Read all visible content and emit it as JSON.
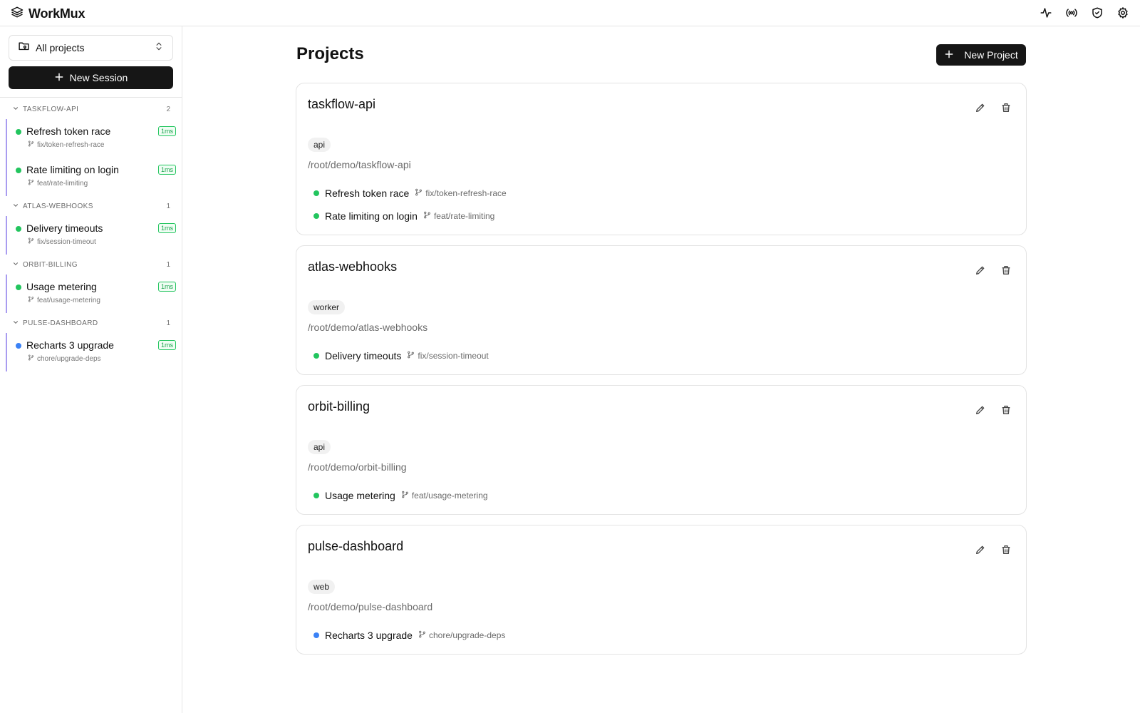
{
  "app": {
    "name": "WorkMux"
  },
  "header": {
    "icons": [
      "activity-icon",
      "broadcast-icon",
      "shield-check-icon",
      "gear-icon"
    ]
  },
  "sidebar": {
    "project_select": "All projects",
    "new_session": "New Session",
    "groups": [
      {
        "name": "TASKFLOW-API",
        "count": "2",
        "sessions": [
          {
            "title": "Refresh token race",
            "branch": "fix/token-refresh-race",
            "badge": "1ms",
            "status": "#22c55e"
          },
          {
            "title": "Rate limiting on login",
            "branch": "feat/rate-limiting",
            "badge": "1ms",
            "status": "#22c55e"
          }
        ]
      },
      {
        "name": "ATLAS-WEBHOOKS",
        "count": "1",
        "sessions": [
          {
            "title": "Delivery timeouts",
            "branch": "fix/session-timeout",
            "badge": "1ms",
            "status": "#22c55e"
          }
        ]
      },
      {
        "name": "ORBIT-BILLING",
        "count": "1",
        "sessions": [
          {
            "title": "Usage metering",
            "branch": "feat/usage-metering",
            "badge": "1ms",
            "status": "#22c55e"
          }
        ]
      },
      {
        "name": "PULSE-DASHBOARD",
        "count": "1",
        "sessions": [
          {
            "title": "Recharts 3 upgrade",
            "branch": "chore/upgrade-deps",
            "badge": "1ms",
            "status": "#3b82f6"
          }
        ]
      }
    ]
  },
  "main": {
    "title": "Projects",
    "new_project": "New Project",
    "projects": [
      {
        "name": "taskflow-api",
        "tag": "api",
        "path": "/root/demo/taskflow-api",
        "sessions": [
          {
            "title": "Refresh token race",
            "branch": "fix/token-refresh-race",
            "status": "#22c55e"
          },
          {
            "title": "Rate limiting on login",
            "branch": "feat/rate-limiting",
            "status": "#22c55e"
          }
        ]
      },
      {
        "name": "atlas-webhooks",
        "tag": "worker",
        "path": "/root/demo/atlas-webhooks",
        "sessions": [
          {
            "title": "Delivery timeouts",
            "branch": "fix/session-timeout",
            "status": "#22c55e"
          }
        ]
      },
      {
        "name": "orbit-billing",
        "tag": "api",
        "path": "/root/demo/orbit-billing",
        "sessions": [
          {
            "title": "Usage metering",
            "branch": "feat/usage-metering",
            "status": "#22c55e"
          }
        ]
      },
      {
        "name": "pulse-dashboard",
        "tag": "web",
        "path": "/root/demo/pulse-dashboard",
        "sessions": [
          {
            "title": "Recharts 3 upgrade",
            "branch": "chore/upgrade-deps",
            "status": "#3b82f6"
          }
        ]
      }
    ]
  }
}
